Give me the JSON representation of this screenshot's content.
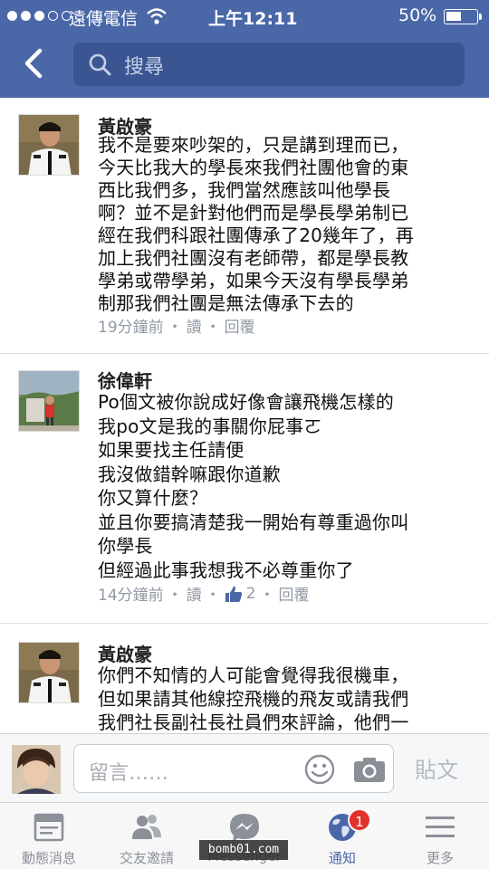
{
  "status_bar": {
    "carrier": "遠傳電信",
    "time": "上午12:11",
    "battery_percent_text": "50%",
    "battery_level": 0.5
  },
  "header": {
    "search_placeholder": "搜尋"
  },
  "comments": [
    {
      "author": "黃啟豪",
      "text": "我不是要來吵架的，只是講到理而已，\n今天比我大的學長來我們社團他會的東\n西比我們多，我們當然應該叫他學長\n啊？並不是針對他們而是學長學弟制已\n經在我們科跟社團傳承了20幾年了，再\n加上我們社團沒有老師帶，都是學長教\n學弟或帶學弟，如果今天沒有學長學弟\n制那我們社團是無法傳承下去的",
      "time": "19分鐘前",
      "read": "讀",
      "reply": "回覆",
      "like_count": ""
    },
    {
      "author": "徐偉軒",
      "text": "Po個文被你說成好像會讓飛機怎樣的\n我po文是我的事關你屁事ㄛ\n如果要找主任請便\n我沒做錯幹嘛跟你道歉\n你又算什麼？\n並且你要搞清楚我一開始有尊重過你叫\n你學長\n但經過此事我想我不必尊重你了",
      "time": "14分鐘前",
      "read": "讀",
      "reply": "回覆",
      "like_count": "2"
    },
    {
      "author": "黃啟豪",
      "text": "你們不知情的人可能會覺得我很機車，\n但如果請其他線控飛機的飛友或請我們\n我們社長副社長社員們來評論，他們一\n定都贊成我的說法的，因為『飛機』是",
      "time": "",
      "read": "",
      "reply": "",
      "like_count": ""
    }
  ],
  "meta_separator": "・",
  "compose": {
    "placeholder": "留言……",
    "post_label": "貼文"
  },
  "tabs": [
    {
      "label": "動態消息",
      "icon": "news-feed-icon"
    },
    {
      "label": "交友邀請",
      "icon": "friend-requests-icon"
    },
    {
      "label": "Messenger",
      "icon": "messenger-icon"
    },
    {
      "label": "通知",
      "icon": "globe-icon",
      "badge": "1",
      "active": true
    },
    {
      "label": "更多",
      "icon": "more-menu-icon"
    }
  ],
  "watermark": "bomb01.com",
  "colors": {
    "brand": "#4a67a8",
    "badge": "#e0312b"
  }
}
